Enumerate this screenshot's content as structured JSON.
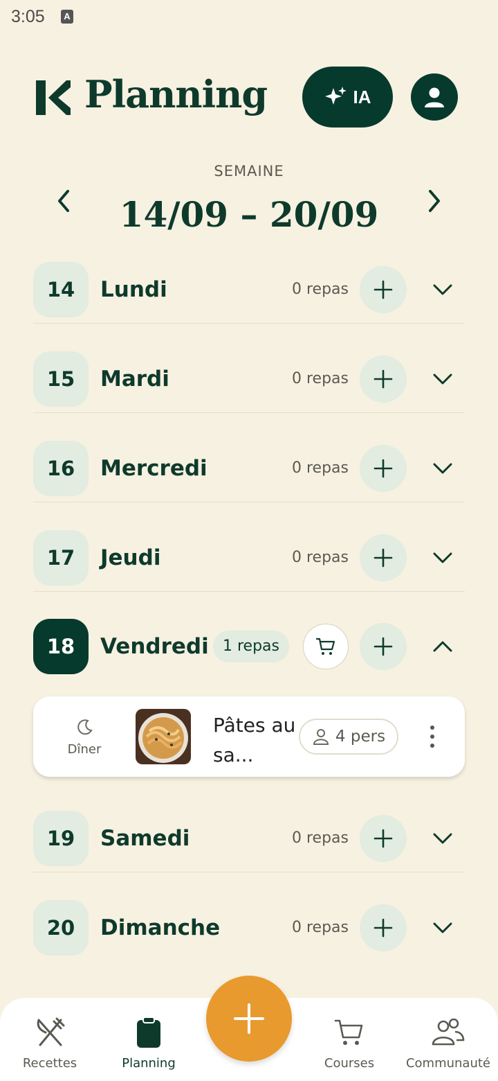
{
  "status_bar": {
    "time": "3:05",
    "indicator": "A"
  },
  "header": {
    "title": "Planning",
    "ia_label": "IA",
    "logo_icon": "k-logo-icon"
  },
  "week": {
    "label": "SEMAINE",
    "range": "14/09 – 20/09"
  },
  "days": [
    {
      "number": "14",
      "name": "Lundi",
      "meals": "0 repas"
    },
    {
      "number": "15",
      "name": "Mardi",
      "meals": "0 repas"
    },
    {
      "number": "16",
      "name": "Mercredi",
      "meals": "0 repas"
    },
    {
      "number": "17",
      "name": "Jeudi",
      "meals": "0 repas"
    },
    {
      "number": "18",
      "name": "Vendredi",
      "meals": "1 repas"
    },
    {
      "number": "19",
      "name": "Samedi",
      "meals": "0 repas"
    },
    {
      "number": "20",
      "name": "Dimanche",
      "meals": "0 repas"
    }
  ],
  "meal": {
    "type_label": "Dîner",
    "title": "Pâtes au sa...",
    "servings": "4 pers"
  },
  "nav": {
    "recettes": "Recettes",
    "planning": "Planning",
    "courses": "Courses",
    "communaute": "Communauté"
  },
  "colors": {
    "primary": "#063a2c",
    "background": "#f7f1e1",
    "accent": "#e89a2e",
    "chip": "#e2ece1"
  }
}
